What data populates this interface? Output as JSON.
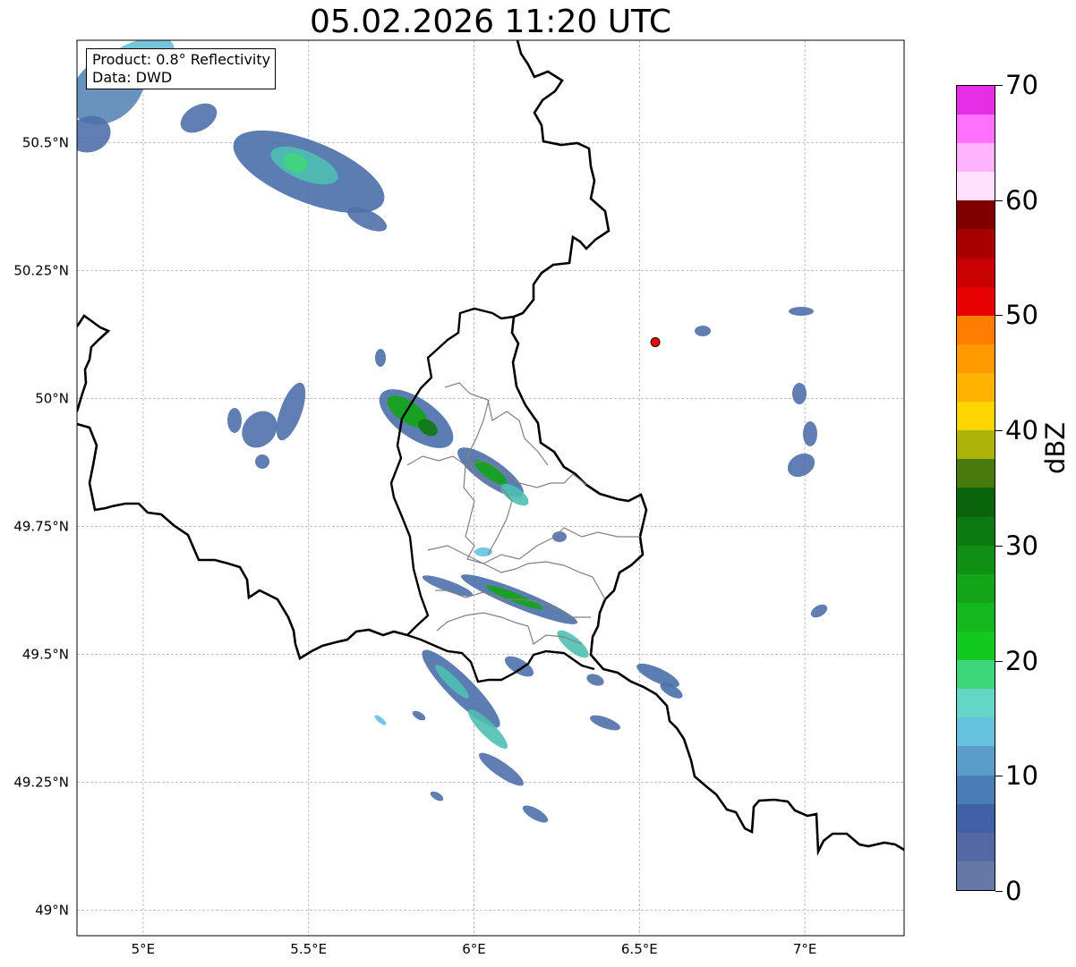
{
  "title": "05.02.2026 11:20 UTC",
  "info": {
    "product": "Product: 0.8° Reflectivity",
    "source": "Data: DWD"
  },
  "map": {
    "lon_range": [
      4.8,
      7.3
    ],
    "lat_range": [
      48.95,
      50.7
    ],
    "lon_ticks": [
      {
        "value": 5.0,
        "label": "5°E"
      },
      {
        "value": 5.5,
        "label": "5.5°E"
      },
      {
        "value": 6.0,
        "label": "6°E"
      },
      {
        "value": 6.5,
        "label": "6.5°E"
      },
      {
        "value": 7.0,
        "label": "7°E"
      }
    ],
    "lat_ticks": [
      {
        "value": 49.0,
        "label": "49°N"
      },
      {
        "value": 49.25,
        "label": "49.25°N"
      },
      {
        "value": 49.5,
        "label": "49.5°N"
      },
      {
        "value": 49.75,
        "label": "49.75°N"
      },
      {
        "value": 50.0,
        "label": "50°N"
      },
      {
        "value": 50.25,
        "label": "50.25°N"
      },
      {
        "value": 50.5,
        "label": "50.5°N"
      }
    ],
    "gridlines": true,
    "radar_site": {
      "lon": 6.548,
      "lat": 50.11,
      "color": "#ff0000"
    }
  },
  "colorbar": {
    "unit": "dBZ",
    "min": 0,
    "max": 70,
    "tick_labels": [
      "0",
      "10",
      "20",
      "30",
      "40",
      "50",
      "60",
      "70"
    ],
    "tick_values": [
      0,
      10,
      20,
      30,
      40,
      50,
      60,
      70
    ],
    "colors": [
      "#6678a8",
      "#5468a3",
      "#4260a6",
      "#4a7db5",
      "#5a9dc8",
      "#66c2de",
      "#63d6c7",
      "#3ed67a",
      "#12c91f",
      "#14b81c",
      "#12a517",
      "#0f8f14",
      "#0c7a10",
      "#0a640c",
      "#487a0c",
      "#adb308",
      "#ffd500",
      "#ffb300",
      "#ff9900",
      "#ff7d00",
      "#e60000",
      "#c80000",
      "#a80000",
      "#800000",
      "#ffe0ff",
      "#ffb3ff",
      "#ff70ff",
      "#e62ee6"
    ]
  }
}
